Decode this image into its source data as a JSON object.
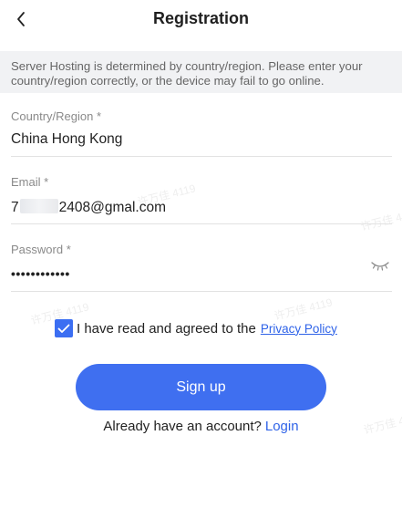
{
  "header": {
    "title": "Registration",
    "back_icon": "chevron-left-icon"
  },
  "notice": {
    "text": "Server Hosting is determined by country/region. Please enter your country/region correctly, or the device may fail to go online."
  },
  "form": {
    "country": {
      "label": "Country/Region *",
      "value": "China Hong Kong"
    },
    "email": {
      "label": "Email *",
      "value_prefix": "7",
      "value_suffix": "2408@gmal.com"
    },
    "password": {
      "label": "Password *",
      "value": "••••••••••••",
      "toggle_icon": "eye-closed-icon"
    }
  },
  "agreement": {
    "checked": true,
    "text": "I have read and agreed to the",
    "link": "Privacy Policy"
  },
  "signup_button": {
    "label": "Sign up"
  },
  "login": {
    "prompt": "Already have an account?",
    "link": "Login"
  },
  "watermark": {
    "text": "许万佳 4119"
  },
  "colors": {
    "accent": "#3f6ff0",
    "link": "#2f63e8",
    "notice_bg": "#f1f2f4"
  }
}
